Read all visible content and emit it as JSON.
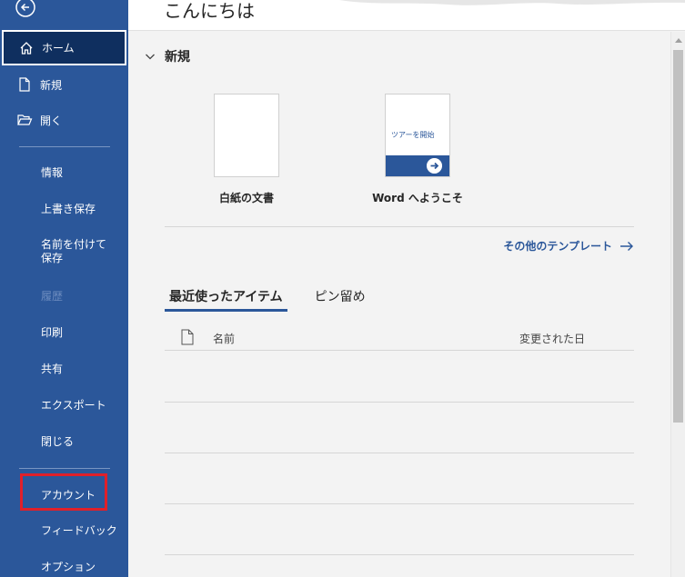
{
  "header": {
    "greeting": "こんにちは"
  },
  "sidebar": {
    "items": [
      {
        "label": "ホーム",
        "icon": "home-icon"
      },
      {
        "label": "新規",
        "icon": "new-document-icon"
      },
      {
        "label": "開く",
        "icon": "open-folder-icon"
      },
      {
        "label": "情報"
      },
      {
        "label": "上書き保存"
      },
      {
        "label": "名前を付けて保存"
      },
      {
        "label": "履歴"
      },
      {
        "label": "印刷"
      },
      {
        "label": "共有"
      },
      {
        "label": "エクスポート"
      },
      {
        "label": "閉じる"
      },
      {
        "label": "アカウント"
      },
      {
        "label": "フィードバック"
      },
      {
        "label": "オプション"
      }
    ]
  },
  "new_section": {
    "title": "新規",
    "templates": [
      {
        "caption": "白紙の文書"
      },
      {
        "caption": "Word へようこそ",
        "thumb_text": "ツアーを開始"
      }
    ],
    "more_templates": "その他のテンプレート"
  },
  "recent": {
    "tabs": [
      "最近使ったアイテム",
      "ピン留め"
    ],
    "columns": {
      "name": "名前",
      "modified": "変更された日"
    }
  },
  "colors": {
    "sidebar": "#2b579a",
    "highlight": "#e0202a"
  }
}
